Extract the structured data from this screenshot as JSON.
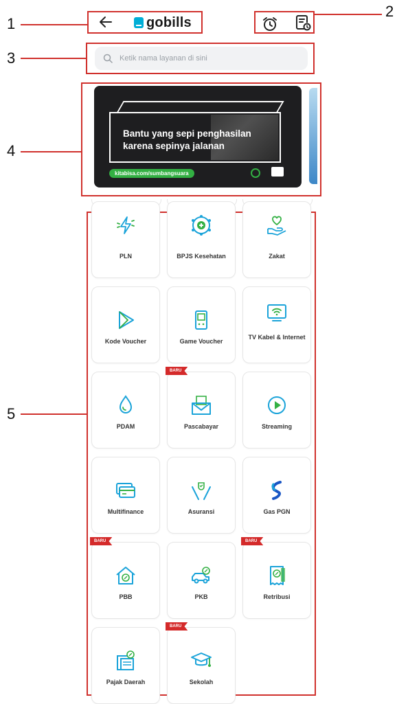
{
  "callouts": [
    "1",
    "2",
    "3",
    "4",
    "5"
  ],
  "header": {
    "logo_text": "gobills"
  },
  "search": {
    "placeholder": "Ketik nama layanan di sini"
  },
  "banner": {
    "line1": "Bantu yang sepi penghasilan",
    "line2": "karena sepinya jalanan",
    "url": "kitabisa.com/sumbangsuara"
  },
  "badge_text": "BARU",
  "services": [
    {
      "label": "PLN",
      "icon": "lightning-icon",
      "baru": false
    },
    {
      "label": "BPJS Kesehatan",
      "icon": "bpjs-icon",
      "baru": false
    },
    {
      "label": "Zakat",
      "icon": "zakat-hand-heart-icon",
      "baru": false
    },
    {
      "label": "Kode Voucher",
      "icon": "play-store-icon",
      "baru": false
    },
    {
      "label": "Game Voucher",
      "icon": "game-device-icon",
      "baru": false
    },
    {
      "label": "TV Kabel & Internet",
      "icon": "tv-wifi-icon",
      "baru": false
    },
    {
      "label": "PDAM",
      "icon": "water-drop-icon",
      "baru": false
    },
    {
      "label": "Pascabayar",
      "icon": "postpaid-envelope-icon",
      "baru": true
    },
    {
      "label": "Streaming",
      "icon": "play-circle-icon",
      "baru": false
    },
    {
      "label": "Multifinance",
      "icon": "cards-icon",
      "baru": false
    },
    {
      "label": "Asuransi",
      "icon": "insurance-hands-icon",
      "baru": false
    },
    {
      "label": "Gas PGN",
      "icon": "gas-pgn-icon",
      "baru": false
    },
    {
      "label": "PBB",
      "icon": "house-tax-icon",
      "baru": true
    },
    {
      "label": "PKB",
      "icon": "car-tax-icon",
      "baru": false
    },
    {
      "label": "Retribusi",
      "icon": "receipt-icon",
      "baru": true
    },
    {
      "label": "Pajak Daerah",
      "icon": "tax-document-icon",
      "baru": false
    },
    {
      "label": "Sekolah",
      "icon": "graduation-cap-icon",
      "baru": true
    }
  ],
  "colors": {
    "accent_green": "#33b043",
    "accent_blue": "#1aa3d9",
    "badge_red": "#d42a2a",
    "callout_red": "#d0302c"
  }
}
